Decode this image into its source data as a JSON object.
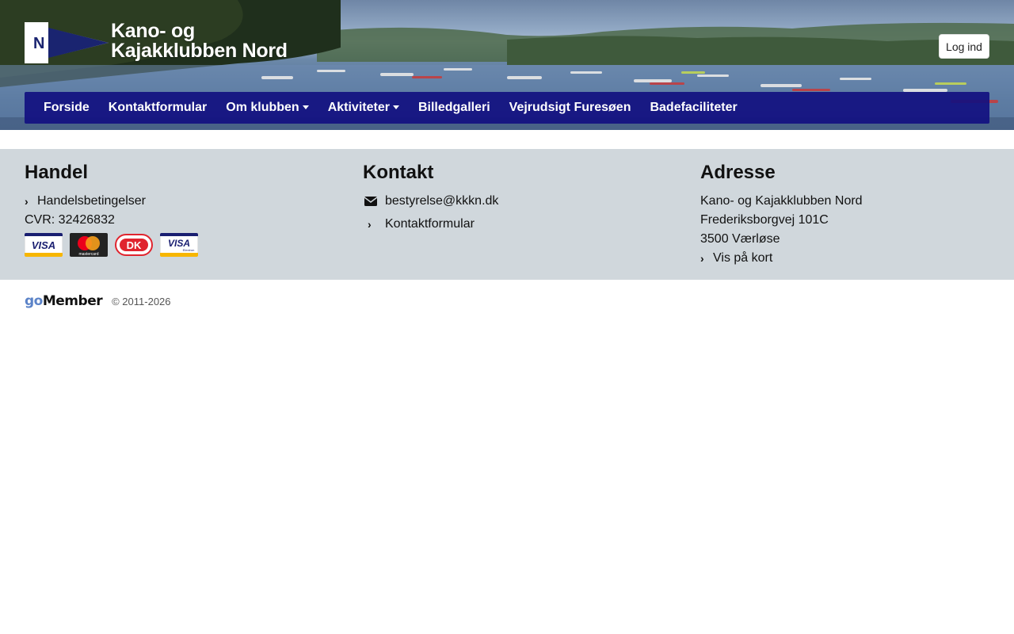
{
  "header": {
    "logo": {
      "line1": "Kano- og",
      "line2": "Kajakklubben Nord",
      "flag_letter": "N"
    },
    "login_label": "Log ind"
  },
  "nav": {
    "items": [
      {
        "label": "Forside",
        "dropdown": false
      },
      {
        "label": "Kontaktformular",
        "dropdown": false
      },
      {
        "label": "Om klubben",
        "dropdown": true
      },
      {
        "label": "Aktiviteter",
        "dropdown": true
      },
      {
        "label": "Billedgalleri",
        "dropdown": false
      },
      {
        "label": "Vejrudsigt Furesøen",
        "dropdown": false
      },
      {
        "label": "Badefaciliteter",
        "dropdown": false
      }
    ]
  },
  "footer": {
    "handel": {
      "title": "Handel",
      "terms_label": "Handelsbetingelser",
      "cvr": "CVR: 32426832",
      "cards": {
        "visa": "VISA",
        "mastercard": "mastercard",
        "dankort": "DK",
        "visa_electron": "VISA",
        "electron_sub": "Electron"
      }
    },
    "kontakt": {
      "title": "Kontakt",
      "email": "bestyrelse@kkkn.dk",
      "form_label": "Kontaktformular"
    },
    "adresse": {
      "title": "Adresse",
      "name": "Kano- og Kajakklubben Nord",
      "street": "Frederiksborgvej 101C",
      "city": "3500 Værløse",
      "map_label": "Vis på kort"
    },
    "brand": {
      "go": "go",
      "member": "Member"
    },
    "copyright": "© 2011-2026"
  },
  "colors": {
    "nav_bg": "#121080",
    "footer_bg": "#d0d7dc",
    "brand_blue": "#5b83c8"
  }
}
